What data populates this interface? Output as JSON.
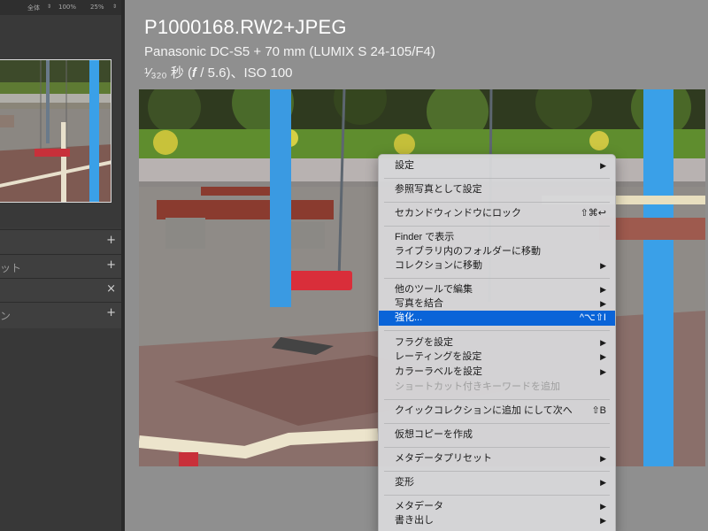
{
  "left_panel": {
    "zoom": {
      "fit": "全体",
      "fit_arrow": "⇕",
      "z100": "100%",
      "z25": "25%",
      "z25_arrow": "⇕"
    },
    "headers": [
      {
        "label": "",
        "button": "+"
      },
      {
        "label": "ット",
        "button": "+"
      },
      {
        "label": "",
        "button": "×"
      },
      {
        "label": "ン",
        "button": "+"
      }
    ]
  },
  "info": {
    "title": "P1000168.RW2+JPEG",
    "camera": "Panasonic DC-S5 + 70 mm (LUMIX S 24-105/F4)",
    "exposure": "¹⁄₃₂₀ 秒 (𝒇 / 5.6)、ISO 100"
  },
  "menu": {
    "items": [
      {
        "label": "設定",
        "shortcut": "",
        "submenu": true
      },
      {
        "label": "参照写真として設定",
        "shortcut": "",
        "submenu": false
      },
      {
        "label": "セカンドウィンドウにロック",
        "shortcut": "⇧⌘↩",
        "submenu": false
      },
      {
        "label": "Finder で表示",
        "shortcut": "",
        "submenu": false
      },
      {
        "label": "ライブラリ内のフォルダーに移動",
        "shortcut": "",
        "submenu": false
      },
      {
        "label": "コレクションに移動",
        "shortcut": "",
        "submenu": true
      },
      {
        "label": "他のツールで編集",
        "shortcut": "",
        "submenu": true
      },
      {
        "label": "写真を結合",
        "shortcut": "",
        "submenu": true
      },
      {
        "label": "強化...",
        "shortcut": "^⌥⇧I",
        "submenu": false
      },
      {
        "label": "フラグを設定",
        "shortcut": "",
        "submenu": true
      },
      {
        "label": "レーティングを設定",
        "shortcut": "",
        "submenu": true
      },
      {
        "label": "カラーラベルを設定",
        "shortcut": "",
        "submenu": true
      },
      {
        "label": "ショートカット付きキーワードを追加",
        "shortcut": "",
        "submenu": false
      },
      {
        "label": "クイックコレクションに追加 にして次へ",
        "shortcut": "⇧B",
        "submenu": false
      },
      {
        "label": "仮想コピーを作成",
        "shortcut": "",
        "submenu": false
      },
      {
        "label": "メタデータプリセット",
        "shortcut": "",
        "submenu": true
      },
      {
        "label": "変形",
        "shortcut": "",
        "submenu": true
      },
      {
        "label": "メタデータ",
        "shortcut": "",
        "submenu": true
      },
      {
        "label": "書き出し",
        "shortcut": "",
        "submenu": true
      }
    ],
    "submenu_arrow": "▶",
    "highlight_color": "#0a64d8"
  },
  "icons": [
    "zoom-stepper-icon",
    "add-icon",
    "close-icon",
    "submenu-arrow-icon"
  ]
}
